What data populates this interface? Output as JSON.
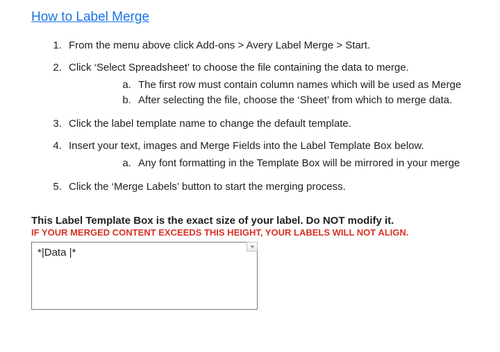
{
  "title": "How to Label Merge",
  "steps": {
    "s1": "From the menu above click Add-ons > Avery Label Merge > Start.",
    "s2": "Click ‘Select Spreadsheet’ to choose the file containing the data to merge.",
    "s2a": "The first row must contain column names which will be used as Merge",
    "s2b": "After selecting the file, choose the ‘Sheet’ from which to merge data.",
    "s3": "Click the label template name to change the default template.",
    "s4": "Insert your text, images and Merge Fields into the Label Template Box below.",
    "s4a": "Any font formatting in the Template Box will be mirrored in your merge",
    "s5": "Click the ‘Merge Labels’ button to start the merging process."
  },
  "warnings": {
    "size_note": "This Label Template Box is the exact size of your label. Do NOT modify it.",
    "align_note": "IF YOUR MERGED CONTENT EXCEEDS THIS HEIGHT, YOUR LABELS WILL NOT ALIGN."
  },
  "template_box": {
    "content": "*|Data |*"
  }
}
